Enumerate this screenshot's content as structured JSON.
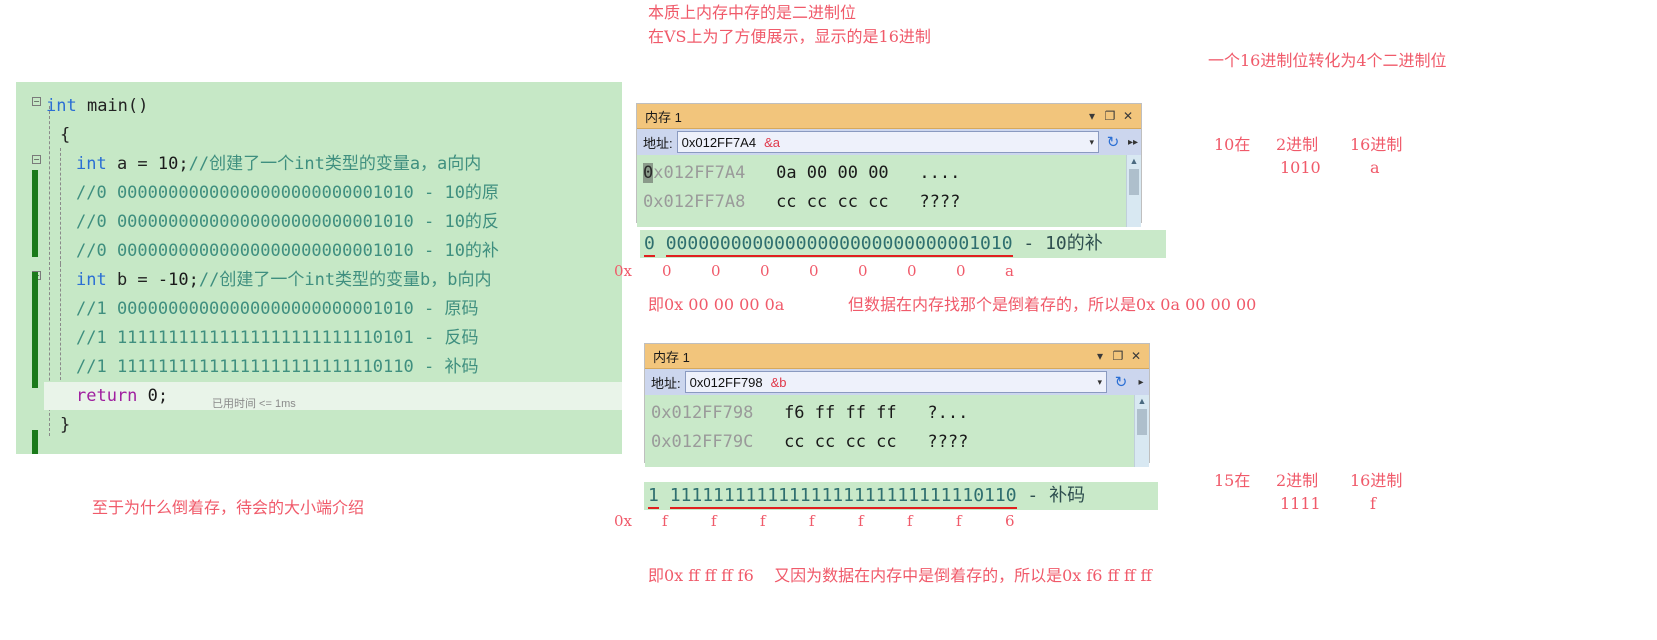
{
  "editor": {
    "lines": [
      {
        "type": "code",
        "parts": [
          {
            "c": "kw",
            "t": "int"
          },
          {
            "c": "plain",
            "t": " main"
          },
          {
            "c": "plain",
            "t": "()"
          }
        ]
      },
      {
        "type": "code",
        "parts": [
          {
            "c": "plain",
            "t": "{"
          }
        ]
      },
      {
        "type": "code",
        "parts": [
          {
            "c": "kw",
            "t": "int"
          },
          {
            "c": "plain",
            "t": " a = "
          },
          {
            "c": "num",
            "t": "10"
          },
          {
            "c": "plain",
            "t": ";"
          },
          {
            "c": "cmt",
            "t": "//创建了一个int类型的变量a，a向内"
          }
        ]
      },
      {
        "type": "code",
        "parts": [
          {
            "c": "cmt",
            "t": "//0 00000000000000000000000001010 - 10的原"
          }
        ]
      },
      {
        "type": "code",
        "parts": [
          {
            "c": "cmt",
            "t": "//0 00000000000000000000000001010 - 10的反"
          }
        ]
      },
      {
        "type": "code",
        "parts": [
          {
            "c": "cmt",
            "t": "//0 00000000000000000000000001010 - 10的补"
          }
        ]
      },
      {
        "type": "code",
        "parts": [
          {
            "c": "kw",
            "t": "int"
          },
          {
            "c": "plain",
            "t": " b = "
          },
          {
            "c": "num",
            "t": "-10"
          },
          {
            "c": "plain",
            "t": ";"
          },
          {
            "c": "cmt",
            "t": "//创建了一个int类型的变量b，b向内"
          }
        ]
      },
      {
        "type": "code",
        "parts": [
          {
            "c": "cmt",
            "t": "//1 00000000000000000000000001010 - 原码"
          }
        ]
      },
      {
        "type": "code",
        "parts": [
          {
            "c": "cmt",
            "t": "//1 11111111111111111111111110101 - 反码"
          }
        ]
      },
      {
        "type": "code",
        "parts": [
          {
            "c": "cmt",
            "t": "//1 11111111111111111111111110110 - 补码"
          }
        ]
      },
      {
        "type": "code",
        "parts": [
          {
            "c": "kw2",
            "t": "return"
          },
          {
            "c": "plain",
            "t": " "
          },
          {
            "c": "num",
            "t": "0"
          },
          {
            "c": "plain",
            "t": ";"
          }
        ]
      },
      {
        "type": "code",
        "parts": [
          {
            "c": "plain",
            "t": "}"
          }
        ]
      }
    ],
    "elapsed_hint": "已用时间 <= 1ms",
    "fold_glyph": "−"
  },
  "memory_window_a": {
    "title": "内存 1",
    "address_label": "地址:",
    "address_value": "0x012FF7A4",
    "address_annotation": "&a",
    "dropdown_caret": "▾",
    "refresh_icon": "↻",
    "overflow_icon": "▸▸",
    "window_buttons": {
      "dropdown": "▾",
      "maximize": "❐",
      "close": "✕"
    },
    "rows": [
      {
        "addr": "0x012FF7A4",
        "hex": "0a 00 00 00",
        "ascii": "....",
        "selected_char": "0"
      },
      {
        "addr": "0x012FF7A8",
        "hex": "cc cc cc cc",
        "ascii": "????",
        "selected_char": ""
      }
    ]
  },
  "memory_window_b": {
    "title": "内存 1",
    "address_label": "地址:",
    "address_value": "0x012FF798",
    "address_annotation": "&b",
    "dropdown_caret": "▾",
    "refresh_icon": "↻",
    "overflow_icon": "▸",
    "window_buttons": {
      "dropdown": "▾",
      "maximize": "❐",
      "close": "✕"
    },
    "rows": [
      {
        "addr": "0x012FF798",
        "hex": "f6 ff ff ff",
        "ascii": "?...",
        "selected_char": ""
      },
      {
        "addr": "0x012FF79C",
        "hex": "cc cc cc cc",
        "ascii": "????",
        "selected_char": ""
      }
    ]
  },
  "binary_strip_a": {
    "sign_bit": "0",
    "nibbles": [
      "0000",
      "0000",
      "0000",
      "0000",
      "0000",
      "0000",
      "0000",
      "1010"
    ],
    "suffix": " - 10的补",
    "hex_prefix": "0x",
    "hex_digits": [
      "0",
      "0",
      "0",
      "0",
      "0",
      "0",
      "0",
      "a"
    ]
  },
  "binary_strip_b": {
    "sign_bit": "1",
    "nibbles": [
      "1111",
      "1111",
      "1111",
      "1111",
      "1111",
      "1111",
      "1111",
      "0110"
    ],
    "suffix": " - 补码",
    "hex_prefix": "0x",
    "hex_digits": [
      "f",
      "f",
      "f",
      "f",
      "f",
      "f",
      "f",
      "6"
    ]
  },
  "notes": {
    "top_line1": "本质上内存中存的是二进制位",
    "top_line2": "在VS上为了方便展示，显示的是16进制",
    "top_right": "一个16进制位转化为4个二进制位",
    "mid_left": "即0x 00 00 00 0a",
    "mid_right": "但数据在内存找那个是倒着存的，所以是0x 0a 00 00 00",
    "bottom_note": "至于为什么倒着存，待会的大小端介绍",
    "bottom_line": "即0x ff ff ff f6    又因为数据在内存中是倒着存的，所以是0x f6 ff ff ff"
  },
  "table_a": {
    "headers": [
      "10在",
      "2进制",
      "16进制"
    ],
    "values": [
      "",
      "1010",
      "a"
    ]
  },
  "table_b": {
    "headers": [
      "15在",
      "2进制",
      "16进制"
    ],
    "values": [
      "",
      "1111",
      "f"
    ]
  },
  "colors": {
    "code_bg": "#c6e8c6",
    "mem_title_bg": "#f2c57c",
    "mem_addrbar_bg": "#ccd6ee",
    "mem_body_bg": "#c9e9c9",
    "annotation_red": "#f05a6a",
    "underline_red": "#e02020",
    "keyword_blue": "#2b6fd4",
    "comment_green": "#3f8f7f"
  }
}
